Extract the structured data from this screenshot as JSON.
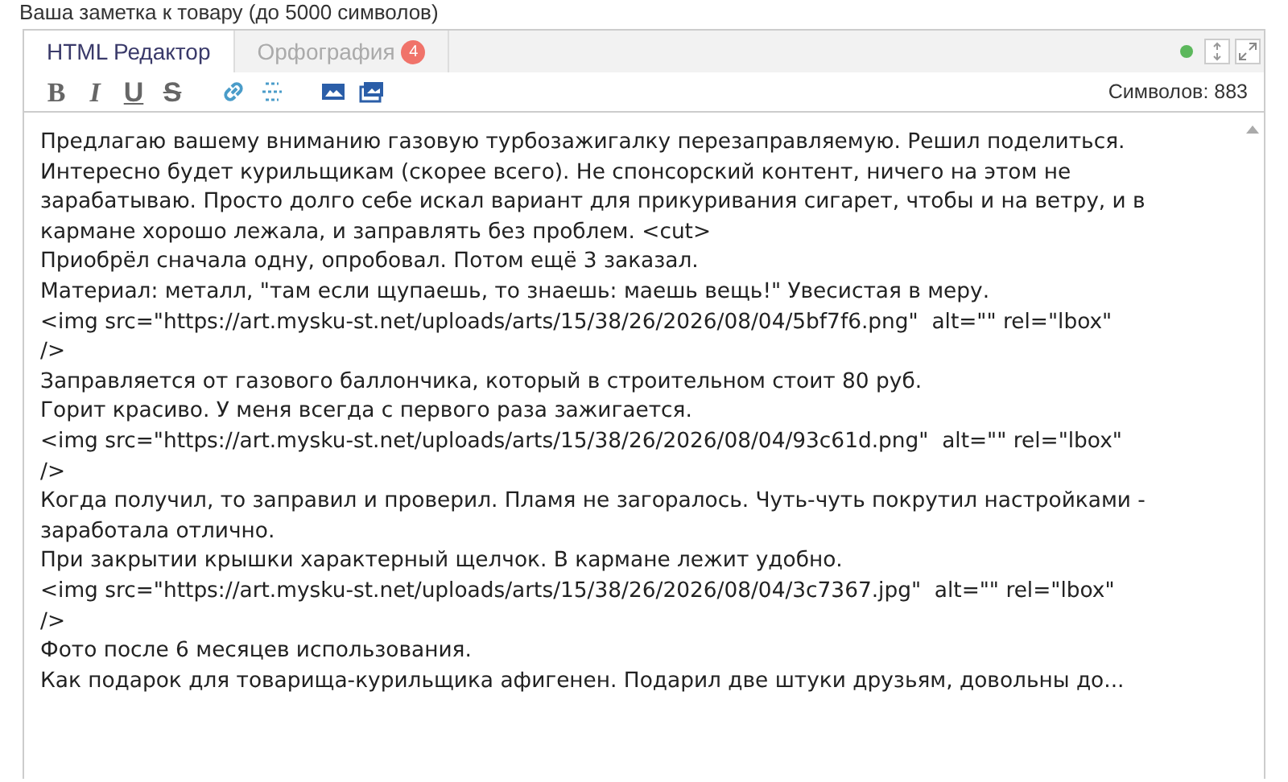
{
  "field_label": "Ваша заметка к товару (до 5000 символов)",
  "tabs": [
    {
      "label": "HTML Редактор",
      "selected": true
    },
    {
      "label": "Орфография",
      "selected": false,
      "badge": "4"
    }
  ],
  "status_dot": {
    "color": "#5cb85c"
  },
  "toolbar": [
    {
      "kind": "bold",
      "label": "B"
    },
    {
      "kind": "italic",
      "label": "I"
    },
    {
      "kind": "underline",
      "label": "U"
    },
    {
      "kind": "strike",
      "label": "S"
    },
    {
      "kind": "gap"
    },
    {
      "kind": "link"
    },
    {
      "kind": "cut"
    },
    {
      "kind": "gap"
    },
    {
      "kind": "image"
    },
    {
      "kind": "gallery"
    }
  ],
  "char_count": "Символов: 883",
  "editor_lines": [
    "Предлагаю вашему вниманию газовую турбозажигалку перезаправляемую. Решил поделиться.",
    "Интересно будет курильщикам (скорее всего). Не спонсорский контент, ничего на этом не",
    "зарабатываю. Просто долго себе искал вариант для прикуривания сигарет, чтобы и на ветру, и в",
    "кармане хорошо лежала, и заправлять без проблем. <cut>",
    "Приобрёл сначала одну, опробовал. Потом ещё 3 заказал.",
    "Материал: металл, \"там если щупаешь, то знаешь: маешь вещь!\" Увесистая в меру.",
    "<img src=\"https://art.mysku-st.net/uploads/arts/15/38/26/2026/08/04/5bf7f6.png\"  alt=\"\" rel=\"lbox\"",
    "/>",
    "Заправляется от газового баллончика, который в строительном стоит 80 руб.",
    "Горит красиво. У меня всегда с первого раза зажигается.",
    "<img src=\"https://art.mysku-st.net/uploads/arts/15/38/26/2026/08/04/93c61d.png\"  alt=\"\" rel=\"lbox\"",
    "/>",
    "Когда получил, то заправил и проверил. Пламя не загоралось. Чуть-чуть покрутил настройками -",
    "заработала отлично.",
    "При закрытии крышки характерный щелчок. В кармане лежит удобно.",
    "<img src=\"https://art.mysku-st.net/uploads/arts/15/38/26/2026/08/04/3c7367.jpg\"  alt=\"\" rel=\"lbox\"",
    "/>",
    "Фото после 6 месяцев использования.",
    "Как подарок для товарища-курильщика афигенен. Подарил две штуки друзьям, довольны до..."
  ]
}
